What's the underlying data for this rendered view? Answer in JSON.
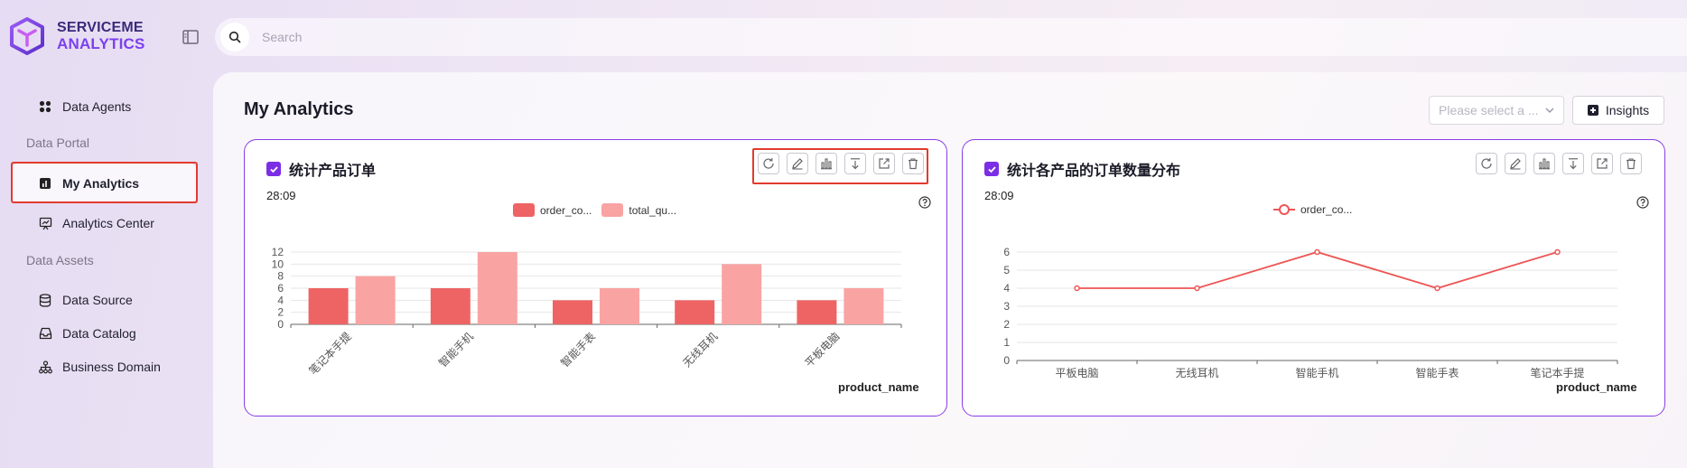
{
  "brand": {
    "line1": "SERVICEME",
    "line2": "ANALYTICS"
  },
  "search": {
    "placeholder": "Search"
  },
  "nav": {
    "items_top": [
      {
        "label": "Data Agents",
        "icon": "grid-dots-icon"
      }
    ],
    "section_portal": "Data Portal",
    "portal_items": [
      {
        "label": "My Analytics",
        "icon": "chart-square-icon",
        "active": true
      },
      {
        "label": "Analytics Center",
        "icon": "presentation-chart-icon"
      }
    ],
    "section_assets": "Data Assets",
    "asset_items": [
      {
        "label": "Data Source",
        "icon": "database-icon"
      },
      {
        "label": "Data Catalog",
        "icon": "inbox-icon"
      },
      {
        "label": "Business Domain",
        "icon": "hierarchy-icon"
      }
    ]
  },
  "page": {
    "title": "My Analytics",
    "select_placeholder": "Please select a ...",
    "insights_label": "Insights"
  },
  "colors": {
    "accent": "#7b2ee6",
    "bar1": "#ee6464",
    "bar2": "#f9a3a3",
    "line": "#ee5555",
    "highlight": "#e23a2e"
  },
  "cards": [
    {
      "title": "统计产品订单",
      "time": "28:09",
      "x_name": "product_name",
      "legend": [
        "order_co...",
        "total_qu..."
      ]
    },
    {
      "title": "统计各产品的订单数量分布",
      "time": "28:09",
      "x_name": "product_name",
      "legend": [
        "order_co..."
      ]
    }
  ],
  "chart_data": [
    {
      "type": "bar",
      "categories": [
        "笔记本手提",
        "智能手机",
        "智能手表",
        "无线耳机",
        "平板电脑"
      ],
      "series": [
        {
          "name": "order_co...",
          "values": [
            6,
            6,
            4,
            4,
            4
          ]
        },
        {
          "name": "total_qu...",
          "values": [
            8,
            12,
            6,
            10,
            6
          ]
        }
      ],
      "yticks": [
        0,
        2,
        4,
        6,
        8,
        10,
        12
      ],
      "ylim": [
        0,
        12
      ],
      "xlabel": "product_name",
      "legend_position": "top-center",
      "grid": true
    },
    {
      "type": "line",
      "categories": [
        "平板电脑",
        "无线耳机",
        "智能手机",
        "智能手表",
        "笔记本手提"
      ],
      "series": [
        {
          "name": "order_co...",
          "values": [
            4,
            4,
            6,
            4,
            6
          ]
        }
      ],
      "yticks": [
        0,
        1,
        2,
        3,
        4,
        5,
        6
      ],
      "ylim": [
        0,
        6
      ],
      "xlabel": "product_name",
      "legend_position": "top-center",
      "grid": true
    }
  ]
}
